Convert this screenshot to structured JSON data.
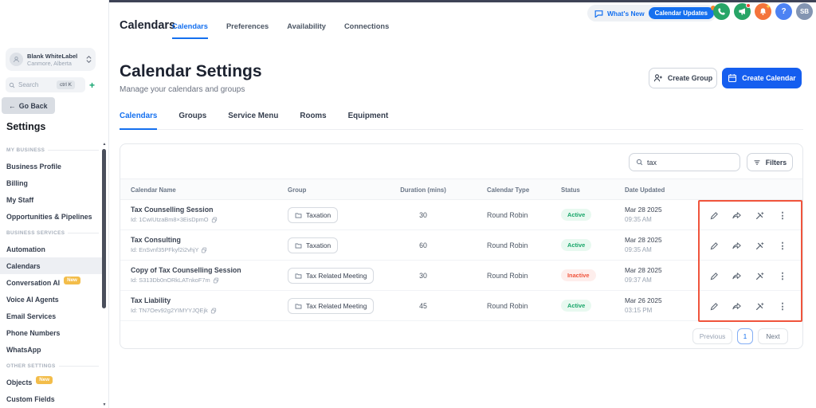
{
  "topnav": {
    "title": "Calendars",
    "tabs": [
      {
        "label": "Calendars"
      },
      {
        "label": "Preferences"
      },
      {
        "label": "Availability"
      },
      {
        "label": "Connections"
      }
    ],
    "whats_new_label": "What's New",
    "calendar_updates_label": "Calendar Updates",
    "help_glyph": "?",
    "avatar_initials": "SB"
  },
  "sidebar": {
    "account": {
      "name": "Blank WhiteLabel",
      "location": "Canmore, Alberta"
    },
    "search": {
      "placeholder": "Search",
      "shortcut": "ctrl K",
      "plus_glyph": "+"
    },
    "back_arrow": "←",
    "back_label": "Go Back",
    "title": "Settings",
    "scroll_up_glyph": "▲",
    "scroll_down_glyph": "▼",
    "sections": [
      {
        "label": "MY BUSINESS",
        "items": [
          {
            "label": "Business Profile"
          },
          {
            "label": "Billing"
          },
          {
            "label": "My Staff"
          },
          {
            "label": "Opportunities & Pipelines"
          }
        ]
      },
      {
        "label": "BUSINESS SERVICES",
        "items": [
          {
            "label": "Automation"
          },
          {
            "label": "Calendars"
          },
          {
            "label": "Conversation AI",
            "badge": "New"
          },
          {
            "label": "Voice AI Agents"
          },
          {
            "label": "Email Services"
          },
          {
            "label": "Phone Numbers"
          },
          {
            "label": "WhatsApp"
          }
        ]
      },
      {
        "label": "OTHER SETTINGS",
        "items": [
          {
            "label": "Objects",
            "badge": "New"
          },
          {
            "label": "Custom Fields"
          }
        ]
      }
    ]
  },
  "main": {
    "title": "Calendar Settings",
    "subtitle": "Manage your calendars and groups",
    "create_group_label": "Create Group",
    "create_calendar_label": "Create Calendar",
    "tabs": [
      {
        "label": "Calendars"
      },
      {
        "label": "Groups"
      },
      {
        "label": "Service Menu"
      },
      {
        "label": "Rooms"
      },
      {
        "label": "Equipment"
      }
    ]
  },
  "table": {
    "search_value": "tax",
    "filters_label": "Filters",
    "columns": [
      "Calendar Name",
      "Group",
      "Duration (mins)",
      "Calendar Type",
      "Status",
      "Date Updated"
    ],
    "kebab_glyph": "⋮",
    "rows": [
      {
        "name": "Tax Counselling Session",
        "id": "Id: 1CwIUtzaBm8×3EisDpmO",
        "group": "Taxation",
        "duration": "30",
        "type": "Round Robin",
        "status": "Active",
        "date": "Mar 28 2025",
        "time": "09:35 AM"
      },
      {
        "name": "Tax Consulting",
        "id": "Id: EnSvnf35PFkyf2i2vhjY",
        "group": "Taxation",
        "duration": "60",
        "type": "Round Robin",
        "status": "Active",
        "date": "Mar 28 2025",
        "time": "09:35 AM"
      },
      {
        "name": "Copy of Tax Counselling Session",
        "id": "Id: S313Db0nORkLATnkoF7m",
        "group": "Tax Related Meeting",
        "duration": "30",
        "type": "Round Robin",
        "status": "Inactive",
        "date": "Mar 28 2025",
        "time": "09:37 AM"
      },
      {
        "name": "Tax Liability",
        "id": "Id: TN7Oev92g2YIMYYJQEjk",
        "group": "Tax Related Meeting",
        "duration": "45",
        "type": "Round Robin",
        "status": "Active",
        "date": "Mar 26 2025",
        "time": "03:15 PM"
      }
    ]
  },
  "pagination": {
    "previous": "Previous",
    "page": "1",
    "next": "Next"
  },
  "annotation": {
    "highlight_color": "#F0543C"
  }
}
